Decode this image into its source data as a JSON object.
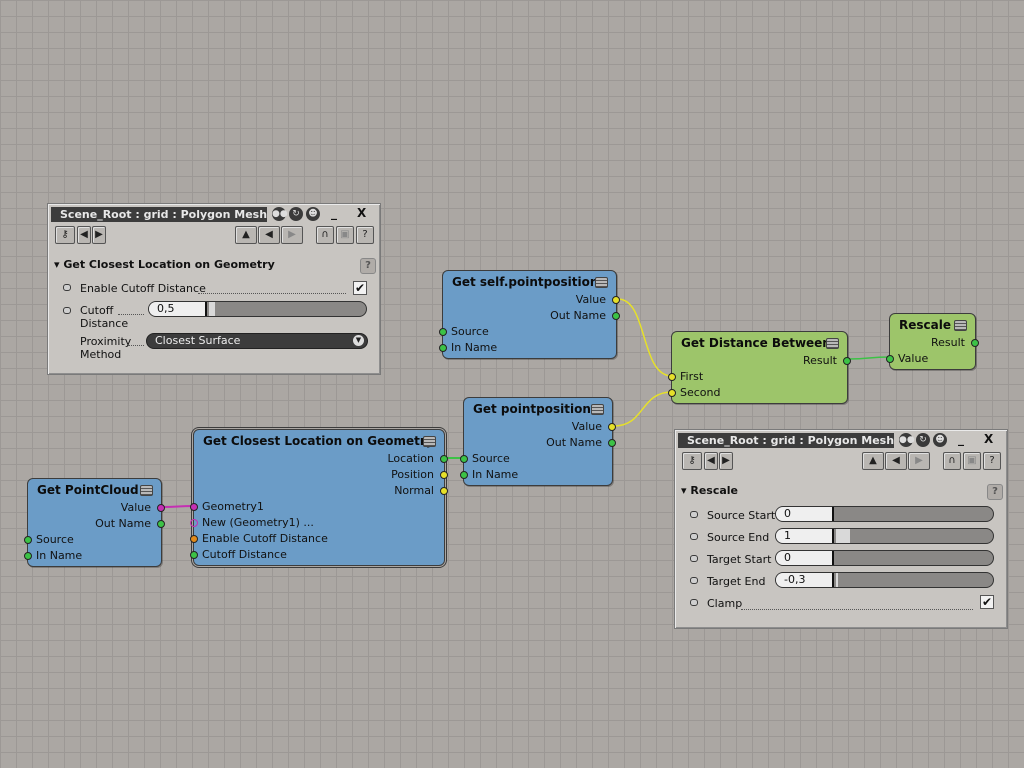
{
  "nodes": {
    "get_pointcloud": {
      "title": "Get PointCloud",
      "out_ports": [
        "Value",
        "Out Name"
      ],
      "in_ports": [
        "Source",
        "In Name"
      ]
    },
    "get_closest_location": {
      "title": "Get Closest Location on Geometry",
      "out_ports": [
        "Location",
        "Position",
        "Normal"
      ],
      "in_ports": [
        "Geometry1",
        "New (Geometry1) ...",
        "Enable Cutoff Distance",
        "Cutoff Distance"
      ]
    },
    "get_self_pointposition": {
      "title": "Get self.pointposition",
      "out_ports": [
        "Value",
        "Out Name"
      ],
      "in_ports": [
        "Source",
        "In Name"
      ]
    },
    "get_pointposition": {
      "title": "Get pointposition",
      "out_ports": [
        "Value",
        "Out Name"
      ],
      "in_ports": [
        "Source",
        "In Name"
      ]
    },
    "get_distance_between": {
      "title": "Get Distance Between",
      "out_ports": [
        "Result"
      ],
      "in_ports": [
        "First",
        "Second"
      ]
    },
    "rescale": {
      "title": "Rescale",
      "out_ports": [
        "Result"
      ],
      "in_ports": [
        "Value"
      ]
    }
  },
  "panel_closest": {
    "title": "Scene_Root : grid : Polygon Mesh : ...",
    "minimize": "_",
    "close": "X",
    "section": "Get Closest Location on Geometry",
    "help": "?",
    "enable_cutoff_label": "Enable Cutoff Distance",
    "enable_cutoff_checked": "✔",
    "cutoff_label_1": "Cutoff",
    "cutoff_label_2": "Distance",
    "cutoff_value": "0,5",
    "cutoff_fraction": 0.04,
    "proximity_label_1": "Proximity",
    "proximity_label_2": "Method",
    "proximity_value": "Closest Surface"
  },
  "panel_rescale": {
    "title": "Scene_Root : grid : Polygon Mesh : ...",
    "minimize": "_",
    "close": "X",
    "section": "Rescale",
    "help": "?",
    "params": [
      {
        "label": "Source Start",
        "value": "0",
        "fraction": 0.0
      },
      {
        "label": "Source End",
        "value": "1",
        "fraction": 0.09
      },
      {
        "label": "Target Start",
        "value": "0",
        "fraction": 0.0
      },
      {
        "label": "Target End",
        "value": "-0,3",
        "fraction": 0.01
      }
    ],
    "clamp_label": "Clamp",
    "clamp_checked": "✔"
  },
  "colors": {
    "wire_yellow": "#e6e02a",
    "wire_green": "#3cc246",
    "wire_magenta": "#c52fb3",
    "node_blue": "#6b9cc7",
    "node_green": "#9dc56a"
  }
}
